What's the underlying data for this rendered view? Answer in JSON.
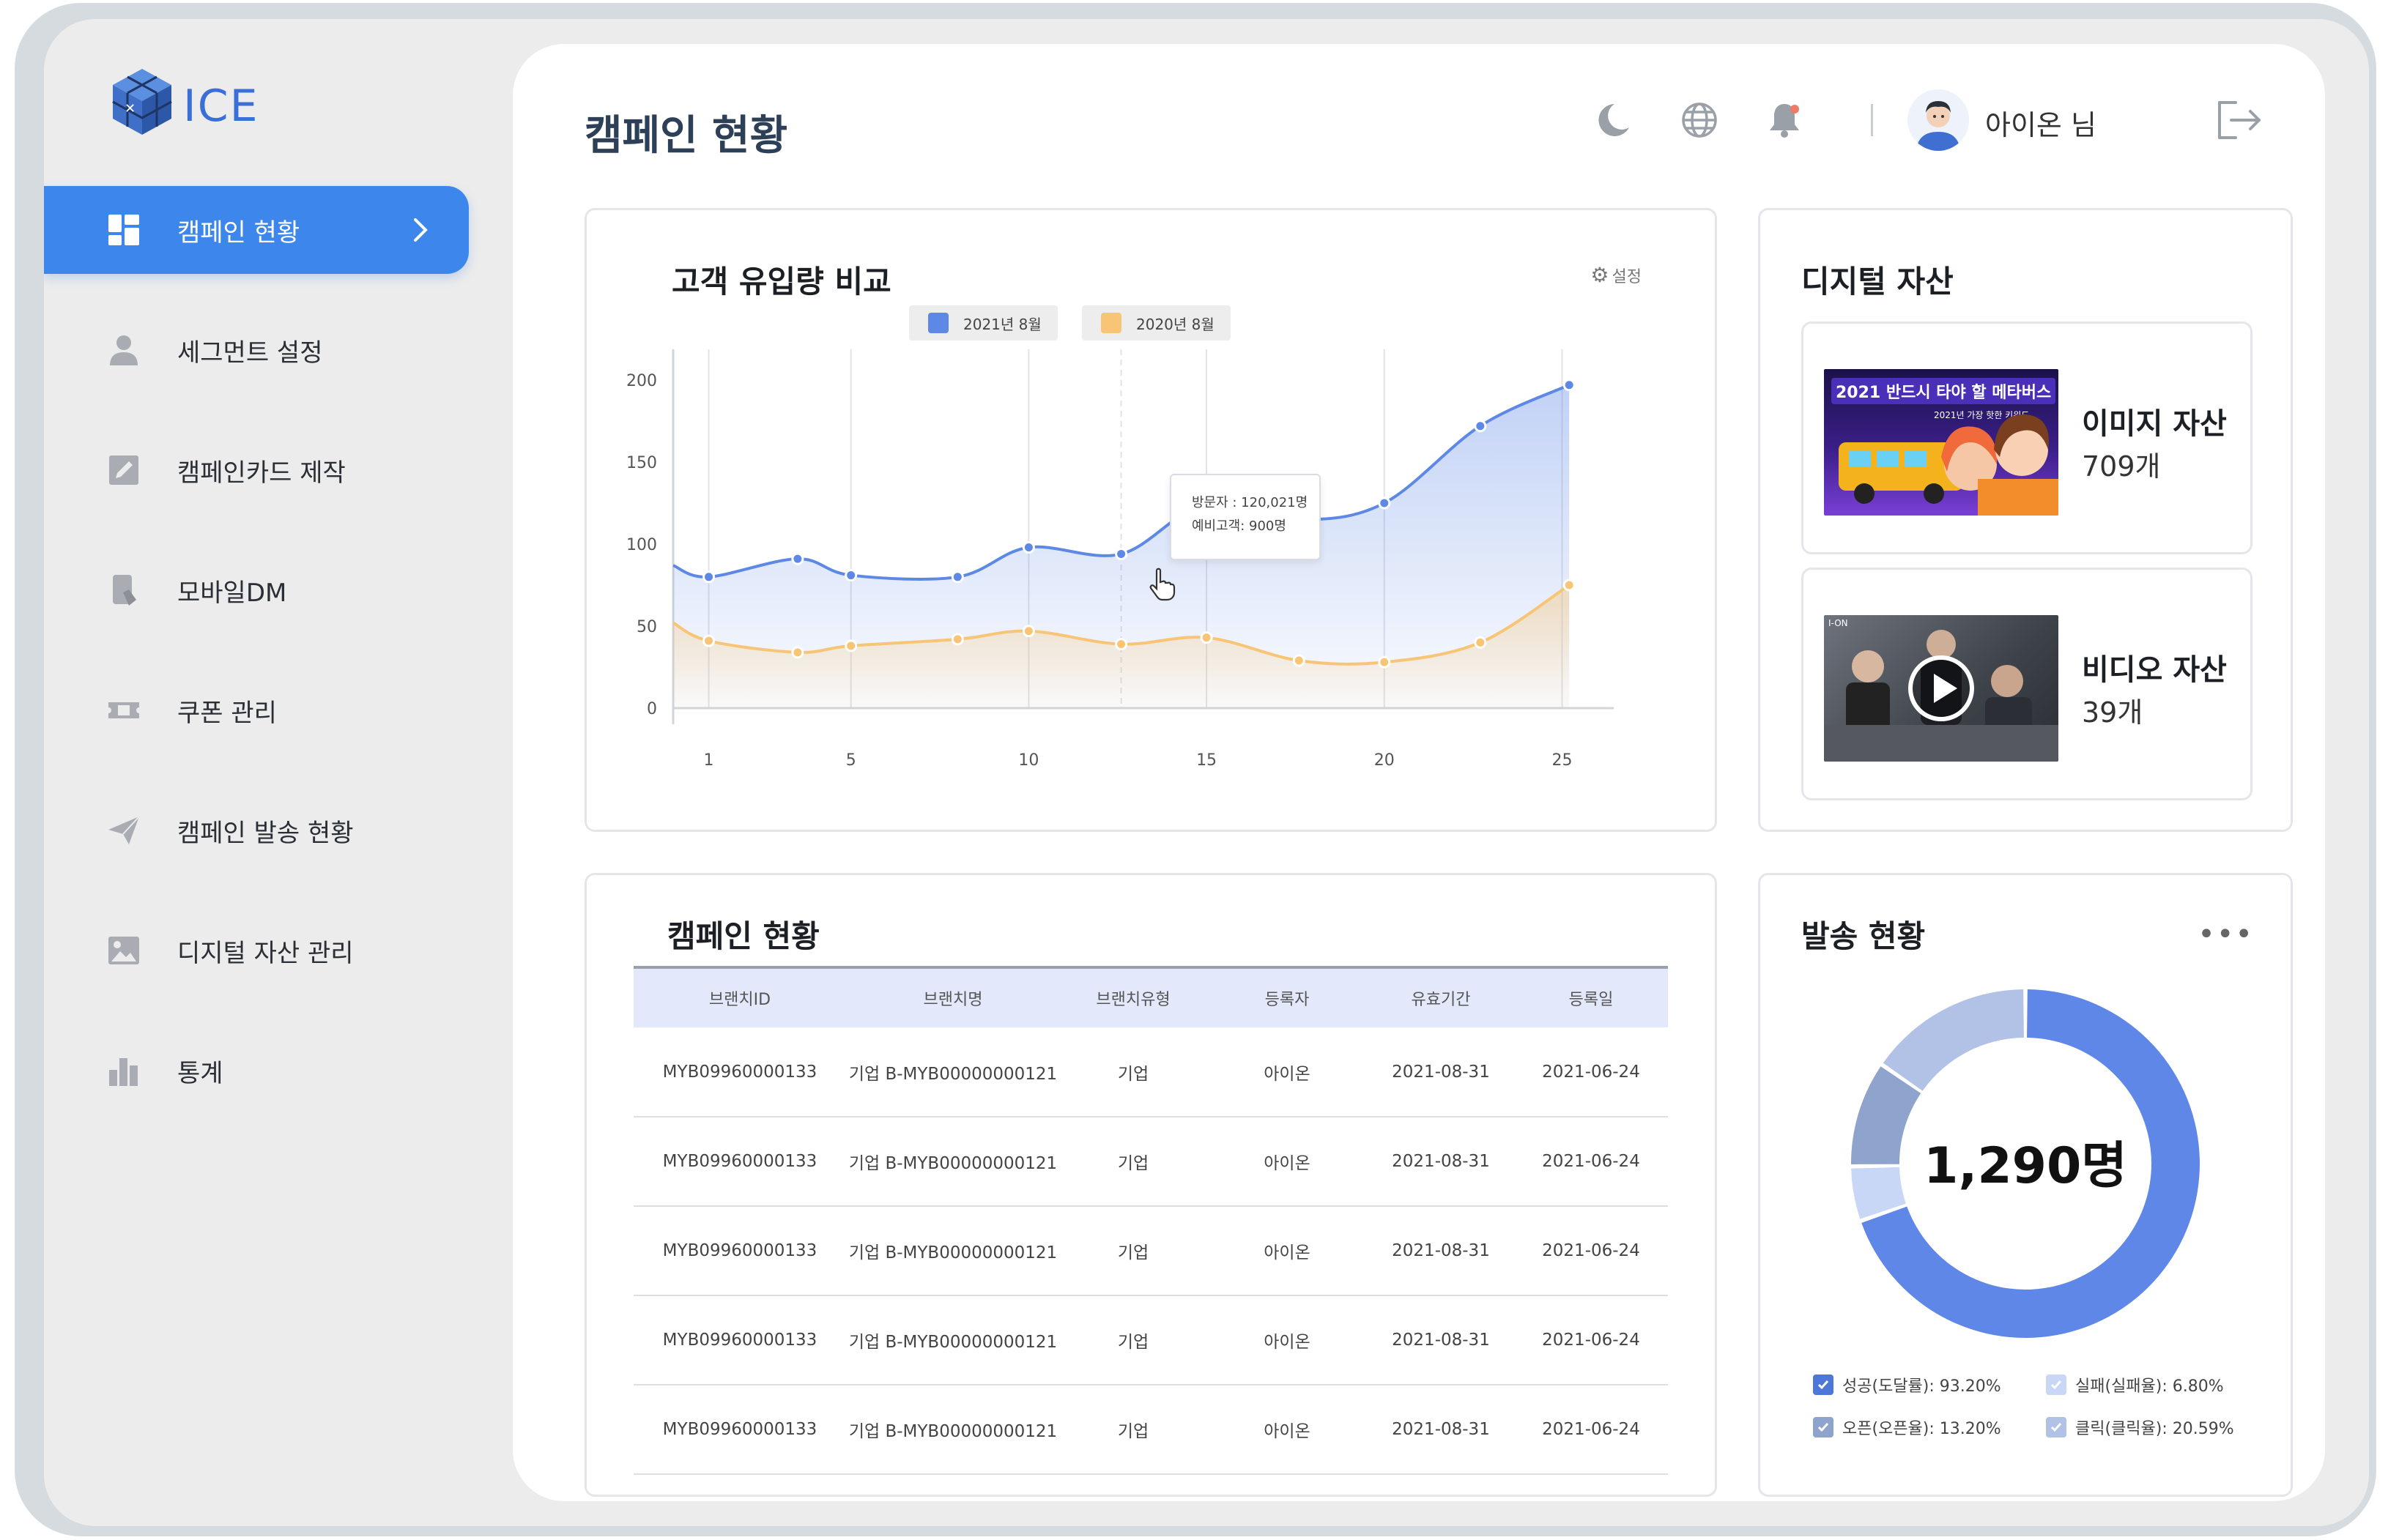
{
  "app": {
    "logo_text": "ICE"
  },
  "sidebar": {
    "items": [
      {
        "label": "캠페인 현황",
        "icon": "dashboard-icon",
        "active": true
      },
      {
        "label": "세그먼트 설정",
        "icon": "user-icon"
      },
      {
        "label": "캠페인카드 제작",
        "icon": "edit-card-icon"
      },
      {
        "label": "모바일DM",
        "icon": "mobile-icon"
      },
      {
        "label": "쿠폰 관리",
        "icon": "ticket-icon"
      },
      {
        "label": "캠페인 발송 현황",
        "icon": "send-icon"
      },
      {
        "label": "디지털 자산 관리",
        "icon": "image-icon"
      },
      {
        "label": "통계",
        "icon": "bar-chart-icon"
      }
    ]
  },
  "header": {
    "page_title": "캠페인 현황",
    "user_name": "아이온 님",
    "icons": [
      "moon-icon",
      "globe-icon",
      "bell-icon",
      "logout-icon"
    ],
    "notification_dot_color": "#f07a6a"
  },
  "traffic_chart": {
    "title": "고객 유입량 비교",
    "settings_label": "설정",
    "tooltip": {
      "line1": "방문자 : 120,021명",
      "line2": "예비고객: 900명"
    }
  },
  "chart_data": [
    {
      "type": "area",
      "title": "고객 유입량 비교",
      "x_ticks": [
        1,
        5,
        10,
        15,
        20,
        25
      ],
      "y_ticks": [
        0,
        50,
        100,
        150,
        200
      ],
      "ylim": [
        0,
        200
      ],
      "xlim": [
        0,
        26
      ],
      "grid": "vertical",
      "legend_position": "top",
      "series": [
        {
          "name": "2021년 8월",
          "color": "#5d88e6",
          "x": [
            1,
            3.5,
            5,
            8,
            10,
            12.6,
            15,
            17.6,
            20,
            22.7,
            25.2
          ],
          "values": [
            80,
            91,
            81,
            80,
            98,
            94,
            125,
            115,
            125,
            172,
            197
          ]
        },
        {
          "name": "2020년 8월",
          "color": "#f8c576",
          "x": [
            1,
            3.5,
            5,
            8,
            10,
            12.6,
            15,
            17.6,
            20,
            22.7,
            25.2
          ],
          "values": [
            41,
            34,
            38,
            42,
            47,
            39,
            43,
            29,
            28,
            40,
            75
          ]
        }
      ]
    },
    {
      "type": "pie",
      "title": "발송 현황",
      "center_label": "1,290명",
      "series": [
        {
          "name": "성공(도달률)",
          "value": 93.2,
          "label": "성공(도달률): 93.20%",
          "color": "#5f87e8"
        },
        {
          "name": "실패(실패율)",
          "value": 6.8,
          "label": "실패(실패율): 6.80%",
          "color": "#c9d7f7"
        },
        {
          "name": "오픈(오픈율)",
          "value": 13.2,
          "label": "오픈(오픈율): 13.20%",
          "color": "#8ea4cc"
        },
        {
          "name": "클릭(클릭율)",
          "value": 20.59,
          "label": "클릭(클릭율): 20.59%",
          "color": "#b2c2e6"
        }
      ]
    }
  ],
  "digital_assets": {
    "title": "디지털 자산",
    "image": {
      "label": "이미지 자산",
      "count": "709개",
      "thumb_caption": "2021 반드시 타야 할 메타버스",
      "thumb_sub": "2021년 가장 핫한 키워드"
    },
    "video": {
      "label": "비디오 자산",
      "count": "39개",
      "thumb_caption": "I-ON"
    }
  },
  "campaign_table": {
    "title": "캠페인 현황",
    "columns": [
      "브랜치ID",
      "브랜치명",
      "브랜치유형",
      "등록자",
      "유효기간",
      "등록일"
    ],
    "rows": [
      [
        "MYB09960000133",
        "기업 B-MYB00000000121",
        "기업",
        "아이온",
        "2021-08-31",
        "2021-06-24"
      ],
      [
        "MYB09960000133",
        "기업 B-MYB00000000121",
        "기업",
        "아이온",
        "2021-08-31",
        "2021-06-24"
      ],
      [
        "MYB09960000133",
        "기업 B-MYB00000000121",
        "기업",
        "아이온",
        "2021-08-31",
        "2021-06-24"
      ],
      [
        "MYB09960000133",
        "기업 B-MYB00000000121",
        "기업",
        "아이온",
        "2021-08-31",
        "2021-06-24"
      ],
      [
        "MYB09960000133",
        "기업 B-MYB00000000121",
        "기업",
        "아이온",
        "2021-08-31",
        "2021-06-24"
      ]
    ]
  },
  "send_status": {
    "title": "발송 현황",
    "more_label": "•••"
  }
}
